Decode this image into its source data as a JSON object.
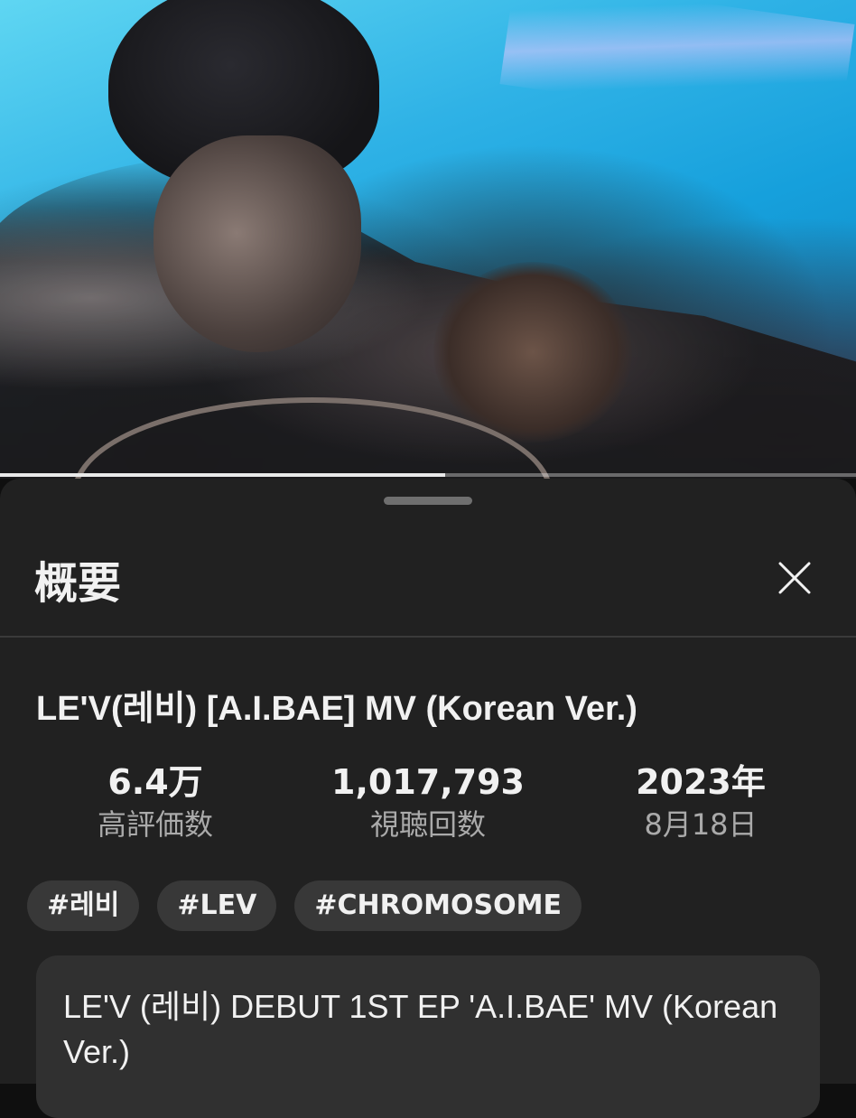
{
  "video": {
    "progress_fraction": 0.52
  },
  "sheet": {
    "title": "概要",
    "close_icon": "close-icon"
  },
  "video_info": {
    "title": "LE'V(레비) [A.I.BAE] MV (Korean Ver.)",
    "stats": [
      {
        "value": "6.4万",
        "label": "高評価数"
      },
      {
        "value": "1,017,793",
        "label": "視聴回数"
      },
      {
        "value": "2023年",
        "label": "8月18日"
      }
    ],
    "hashtags": [
      "#레비",
      "#LEV",
      "#CHROMOSOME"
    ],
    "description": "LE'V (레비) DEBUT 1ST EP 'A.I.BAE' MV (Korean Ver.)"
  },
  "colors": {
    "background": "#0f0f0f",
    "sheet": "#212121",
    "chip": "#383838",
    "card": "#303030",
    "secondary_text": "#aaaaaa"
  }
}
